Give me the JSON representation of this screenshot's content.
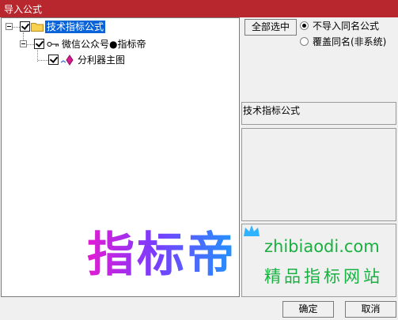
{
  "window": {
    "title": "导入公式"
  },
  "tree": {
    "root": {
      "label": "技术指标公式",
      "icon": "folder-icon",
      "checked": true,
      "expanded": true
    },
    "child": {
      "label": "微信公众号●指标帝",
      "icon": "key-icon",
      "checked": true,
      "expanded": true
    },
    "leaf": {
      "label": "分利器主图",
      "icon": "formula-gem-icon",
      "checked": true
    }
  },
  "right": {
    "select_all_button": "全部选中",
    "options": [
      {
        "label": "不导入同名公式",
        "selected": true
      },
      {
        "label": "覆盖同名(非系统)",
        "selected": false
      }
    ],
    "info_label": "技术指标公式"
  },
  "watermark": {
    "brand": "指标帝",
    "url": "zhibiaodi.com",
    "slogan": "精品指标网站"
  },
  "footer": {
    "ok_button": "确定",
    "cancel_button": "取消"
  },
  "colors": {
    "titlebar": "#b8272e",
    "selection": "#0a64d8",
    "watermark_green": "#18b040"
  }
}
